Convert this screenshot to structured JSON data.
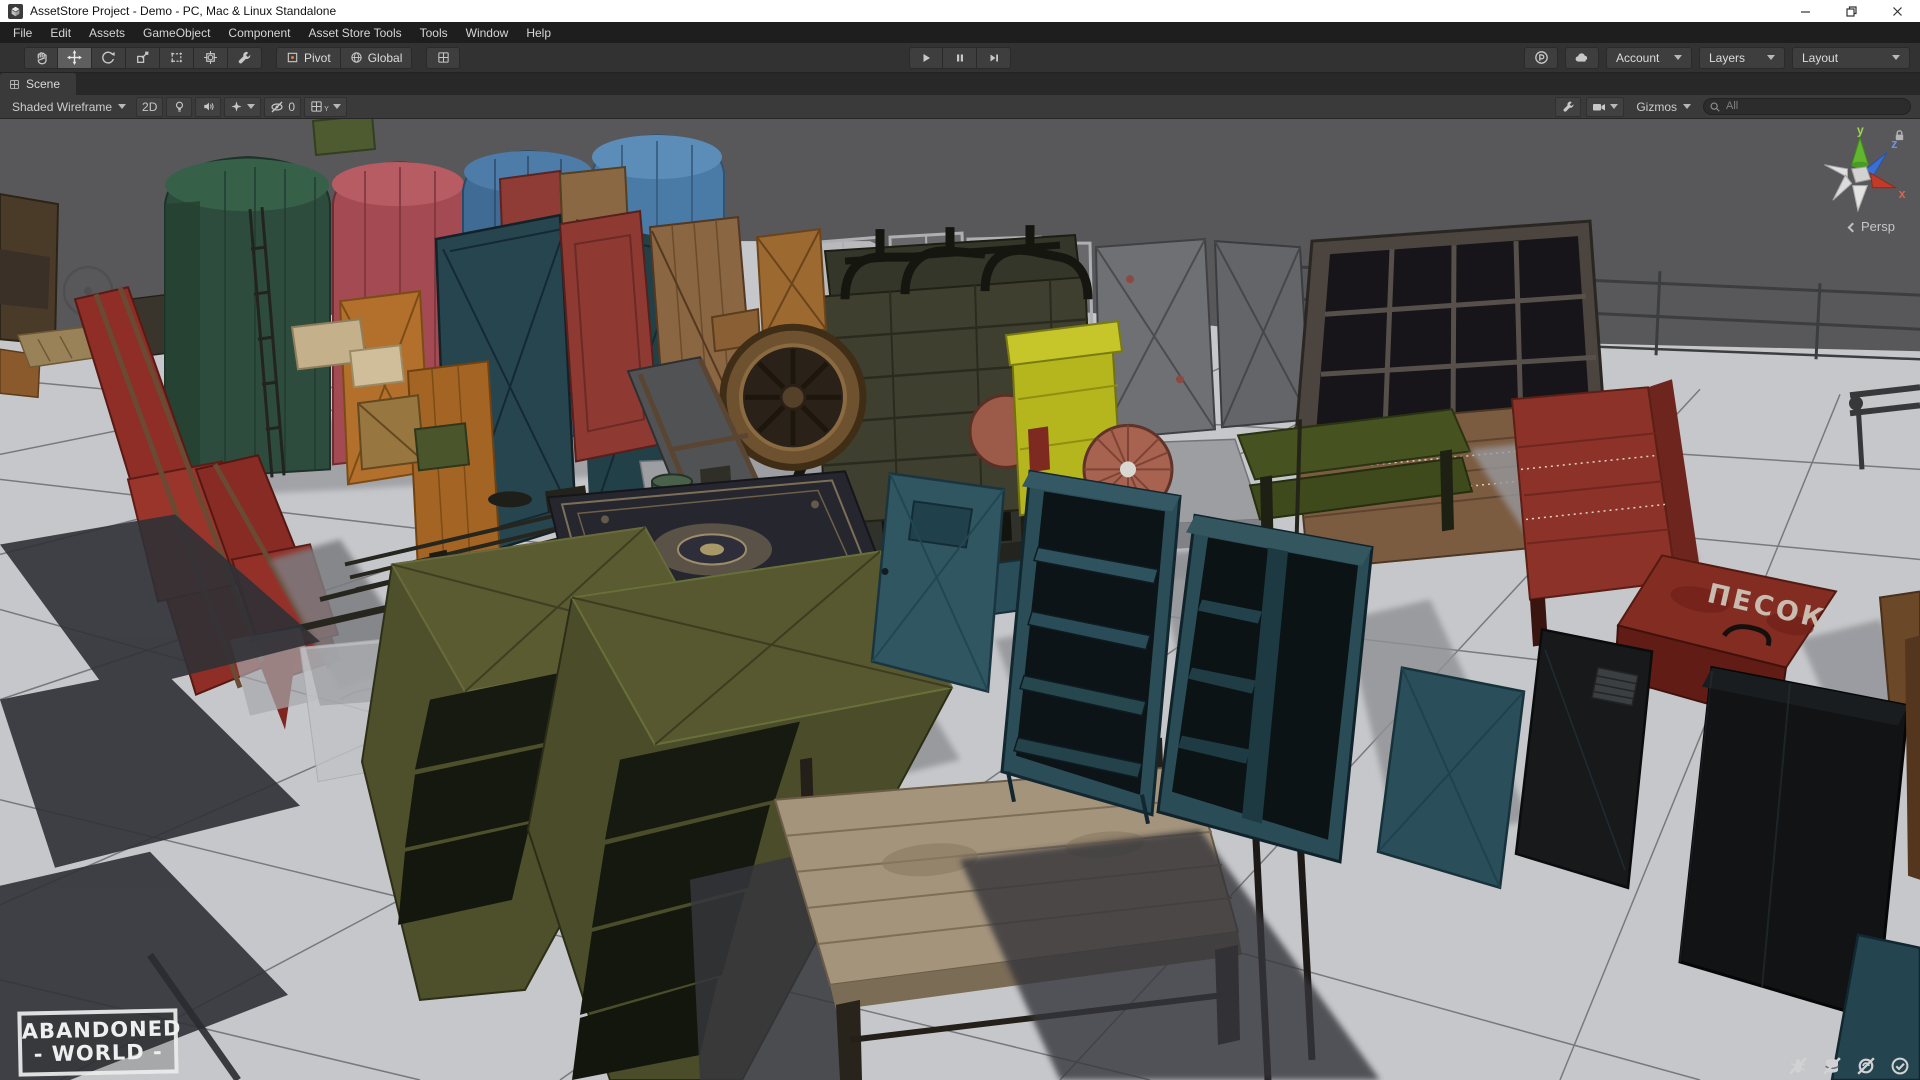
{
  "window": {
    "title": "AssetStore Project - Demo - PC, Mac & Linux Standalone"
  },
  "menubar": {
    "items": [
      "File",
      "Edit",
      "Assets",
      "GameObject",
      "Component",
      "Asset Store Tools",
      "Tools",
      "Window",
      "Help"
    ]
  },
  "toolbar": {
    "pivot": "Pivot",
    "global": "Global",
    "account": "Account",
    "layers": "Layers",
    "layout": "Layout"
  },
  "scene_tab": {
    "label": "Scene"
  },
  "scene_controls": {
    "draw_mode": "Shaded Wireframe",
    "mode_2d": "2D",
    "hidden_count": "0",
    "grid_axis": "Y",
    "gizmos": "Gizmos",
    "search_placeholder": "All"
  },
  "viewport": {
    "gizmo": {
      "axis_x": "x",
      "axis_y": "y",
      "axis_z": "z",
      "projection": "Persp"
    },
    "watermark": {
      "line1": "ABANDONED",
      "line2": "- WORLD -"
    },
    "crate_label": "ПЕСОК",
    "colors": {
      "sky": "#58585a",
      "floor": "#c6c7ca",
      "wireframe": "#4a4b4d",
      "tank_green": "#2d4c3d",
      "tank_red": "#a34a52",
      "tank_blue": "#4a7aa6",
      "teal_cabinet": "#2b4d58",
      "olive_shelf": "#565631",
      "red_crate": "#832c22",
      "engine_olive": "#3e3f2f",
      "generator_yellow": "#b5b51e",
      "flywheel_rust": "#6e5230",
      "axis_x_red": "#c03b2a",
      "axis_y_green": "#61b52f",
      "axis_z_blue": "#3a6fd4"
    },
    "scene_objects": [
      "water-tank-green",
      "water-tank-red",
      "water-tanks-blue",
      "metal-gates",
      "red-door",
      "wooden-door",
      "glass-doors",
      "diesel-engine",
      "flywheel",
      "yellow-generator",
      "storage-rack",
      "metal-panels",
      "fence-rails",
      "garden-bench",
      "red-shelf",
      "sand-crate",
      "teal-lockers",
      "teal-doors",
      "dark-vent-door",
      "dark-cabinet",
      "olive-shelving",
      "wooden-table",
      "persian-carpet",
      "faded-rug",
      "red-ladder-chairs",
      "gray-ladder-chair",
      "orange-cabinets",
      "floor-pipes",
      "ammo-boxes",
      "desk-fan",
      "pallet",
      "green-barrel"
    ]
  },
  "status_icons": [
    "bug-disabled",
    "cache-disabled",
    "connection-disabled",
    "tasks-complete"
  ]
}
